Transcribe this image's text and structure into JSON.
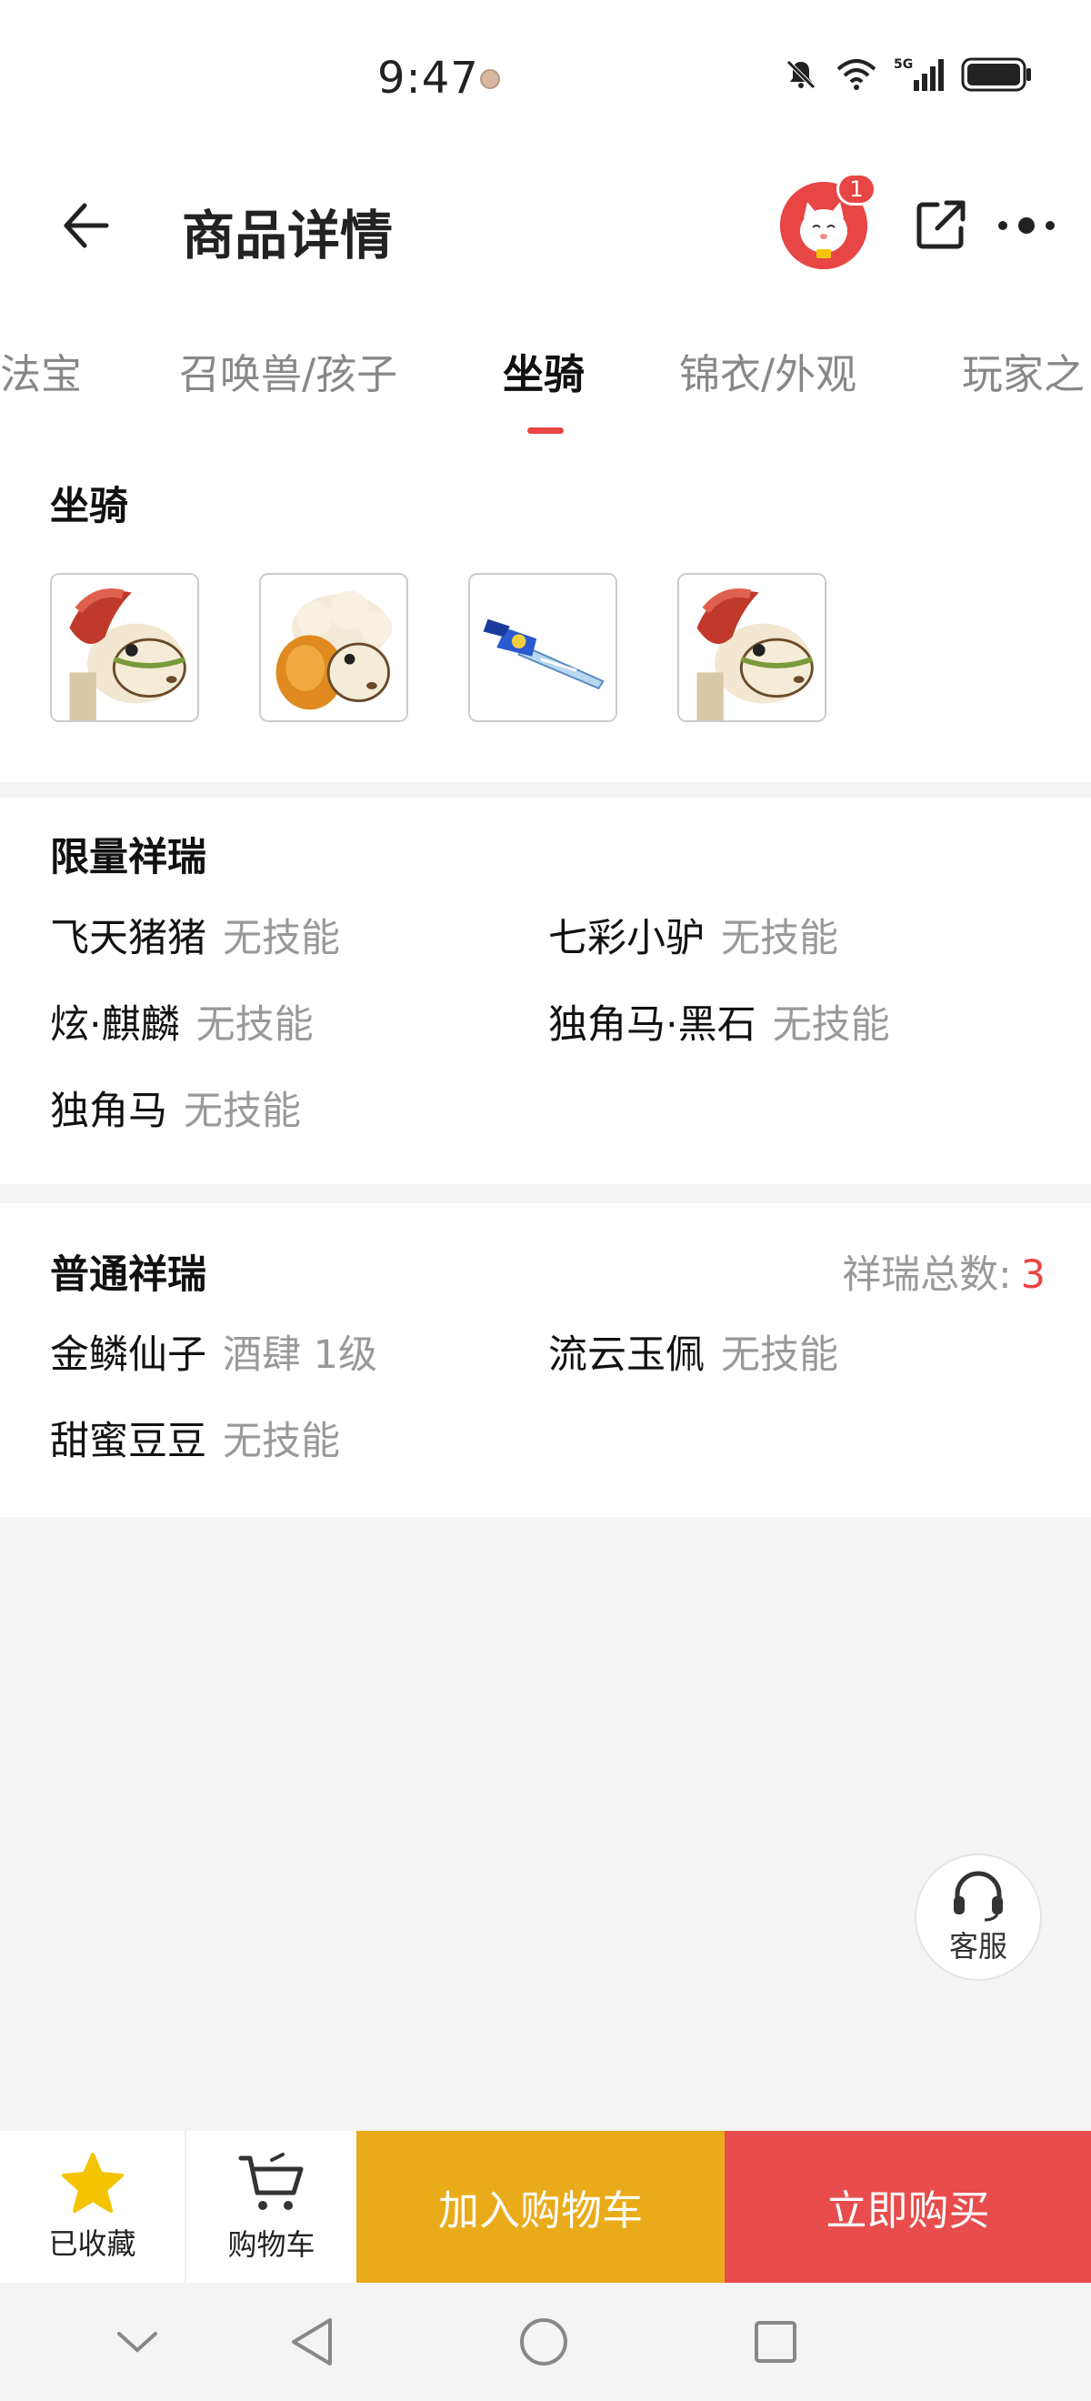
{
  "status": {
    "time": "9:47",
    "network": "5G"
  },
  "header": {
    "title": "商品详情",
    "badge_count": "1"
  },
  "tabs": [
    {
      "label": "法宝",
      "active": false
    },
    {
      "label": "召唤兽/孩子",
      "active": false
    },
    {
      "label": "坐骑",
      "active": true
    },
    {
      "label": "锦衣/外观",
      "active": false
    },
    {
      "label": "玩家之",
      "active": false
    }
  ],
  "mount_section": {
    "title": "坐骑",
    "thumbnails": [
      "horse-red-mane",
      "sheep-mount",
      "blue-sword",
      "horse-red-mane"
    ]
  },
  "limited_section": {
    "title": "限量祥瑞",
    "items": [
      {
        "name": "飞天猪猪",
        "skill": "无技能"
      },
      {
        "name": "七彩小驴",
        "skill": "无技能"
      },
      {
        "name": "炫·麒麟",
        "skill": "无技能"
      },
      {
        "name": "独角马·黑石",
        "skill": "无技能"
      },
      {
        "name": "独角马",
        "skill": "无技能"
      }
    ]
  },
  "normal_section": {
    "title": "普通祥瑞",
    "total_label": "祥瑞总数:",
    "total_value": "3",
    "items": [
      {
        "name": "金鳞仙子",
        "skill": "酒肆 1级"
      },
      {
        "name": "流云玉佩",
        "skill": "无技能"
      },
      {
        "name": "甜蜜豆豆",
        "skill": "无技能"
      }
    ]
  },
  "customer_service": {
    "label": "客服"
  },
  "bottom_bar": {
    "favorite_label": "已收藏",
    "cart_label": "购物车",
    "add_to_cart_label": "加入购物车",
    "buy_now_label": "立即购买"
  },
  "colors": {
    "accent_red": "#e84545",
    "cart_yellow": "#eaab1a",
    "star_yellow": "#f5c400"
  }
}
